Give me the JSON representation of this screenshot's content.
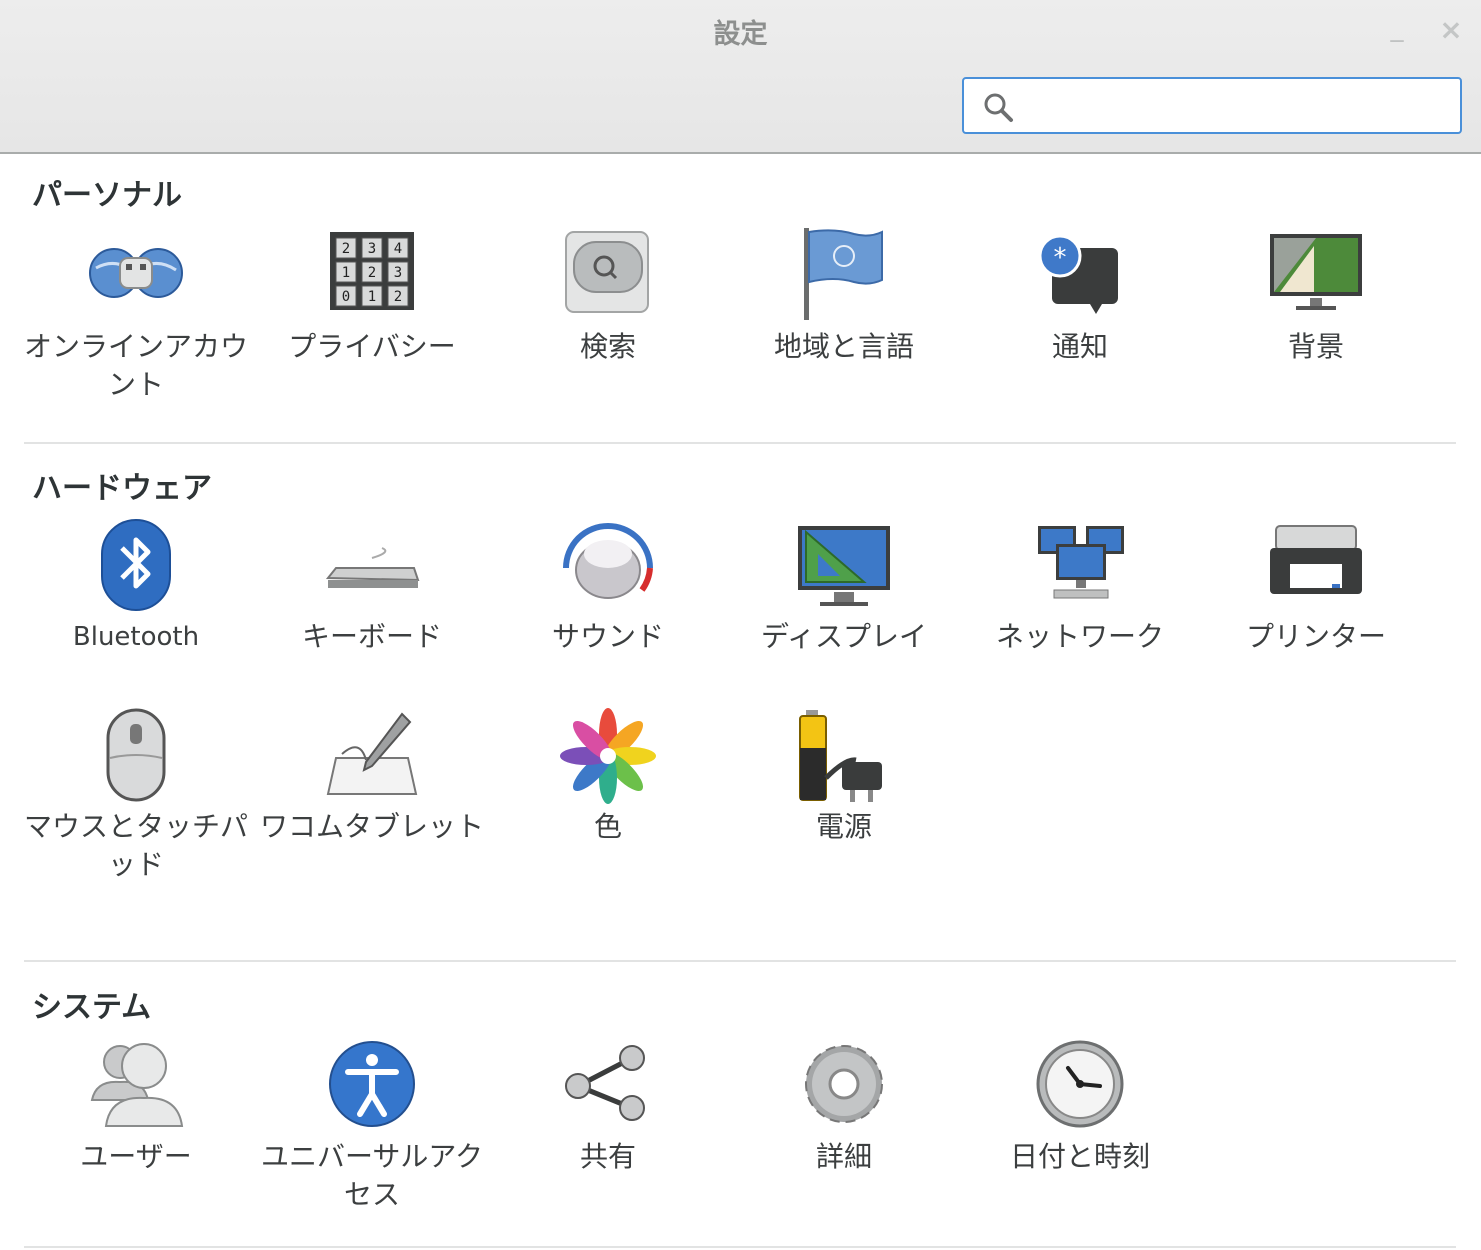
{
  "window": {
    "title": "設定",
    "minimize_glyph": "_",
    "close_glyph": "×"
  },
  "search": {
    "placeholder": "",
    "value": "",
    "icon": "search-icon"
  },
  "sections": {
    "personal": {
      "title": "パーソナル",
      "items": [
        {
          "label": "オンラインアカウント",
          "icon": "online-accounts-icon"
        },
        {
          "label": "プライバシー",
          "icon": "privacy-icon"
        },
        {
          "label": "検索",
          "icon": "search-settings-icon"
        },
        {
          "label": "地域と言語",
          "icon": "region-language-icon"
        },
        {
          "label": "通知",
          "icon": "notifications-icon"
        },
        {
          "label": "背景",
          "icon": "background-icon"
        }
      ]
    },
    "hardware": {
      "title": "ハードウェア",
      "items": [
        {
          "label": "Bluetooth",
          "icon": "bluetooth-icon"
        },
        {
          "label": "キーボード",
          "icon": "keyboard-icon"
        },
        {
          "label": "サウンド",
          "icon": "sound-icon"
        },
        {
          "label": "ディスプレイ",
          "icon": "display-icon"
        },
        {
          "label": "ネットワーク",
          "icon": "network-icon"
        },
        {
          "label": "プリンター",
          "icon": "printer-icon"
        },
        {
          "label": "マウスとタッチパッド",
          "icon": "mouse-icon"
        },
        {
          "label": "ワコムタブレット",
          "icon": "wacom-tablet-icon"
        },
        {
          "label": "色",
          "icon": "color-icon"
        },
        {
          "label": "電源",
          "icon": "power-icon"
        }
      ]
    },
    "system": {
      "title": "システム",
      "items": [
        {
          "label": "ユーザー",
          "icon": "users-icon"
        },
        {
          "label": "ユニバーサルアクセス",
          "icon": "universal-access-icon"
        },
        {
          "label": "共有",
          "icon": "sharing-icon"
        },
        {
          "label": "詳細",
          "icon": "details-icon"
        },
        {
          "label": "日付と時刻",
          "icon": "date-time-icon"
        }
      ]
    }
  },
  "colors": {
    "accent": "#4a90d9",
    "title_text": "#8d8f8e",
    "label_text": "#3c3f40"
  }
}
